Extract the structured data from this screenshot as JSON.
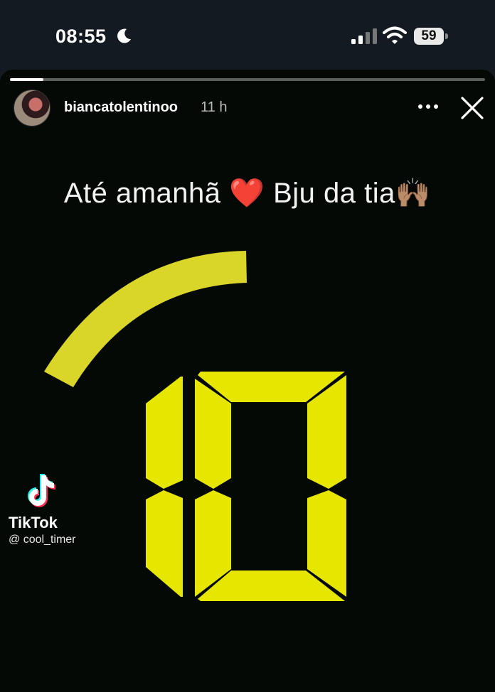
{
  "status_bar": {
    "time": "08:55",
    "battery": "59",
    "icons": [
      "moon-icon",
      "signal-icon",
      "wifi-icon",
      "battery-icon"
    ]
  },
  "story": {
    "progress": 0.07,
    "username": "biancatolentinoo",
    "time_ago": "11 h",
    "caption": {
      "text": "Até amanhã",
      "heart": "❤️",
      "text2": "Bju da tia",
      "emoji": "🙌🏽"
    },
    "timer": {
      "digits": "10",
      "color": "#e6e600",
      "arc_color": "#d9d629"
    },
    "watermark": {
      "brand": "TikTok",
      "handle": "@ cool_timer"
    }
  }
}
